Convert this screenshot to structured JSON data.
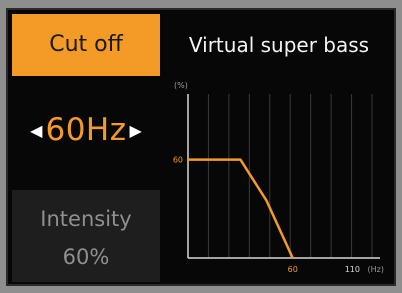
{
  "left_panel": {
    "cutoff_tab_label": "Cut off",
    "frequency_value": "60Hz",
    "left_arrow": "◀",
    "right_arrow": "▶",
    "intensity_label": "Intensity",
    "intensity_value": "60%"
  },
  "right_panel": {
    "title": "Virtual super bass"
  },
  "chart_data": {
    "type": "line",
    "series": [
      {
        "x": [
          0,
          30,
          45,
          60
        ],
        "values": [
          60,
          60,
          35,
          0
        ]
      }
    ],
    "y_tick_labels": [
      "60"
    ],
    "x_tick_labels": [
      "60",
      "110"
    ],
    "ylabel": "(%)",
    "xlabel": "(Hz)",
    "xlim": [
      0,
      110
    ],
    "ylim": [
      0,
      100
    ],
    "grid": true,
    "line_color": "#f39a27",
    "label_color": "#f39a27"
  },
  "colors": {
    "accent": "#f39a27",
    "background": "#070707",
    "text_primary": "#f3f3f3",
    "text_muted": "#8f8f8f"
  }
}
